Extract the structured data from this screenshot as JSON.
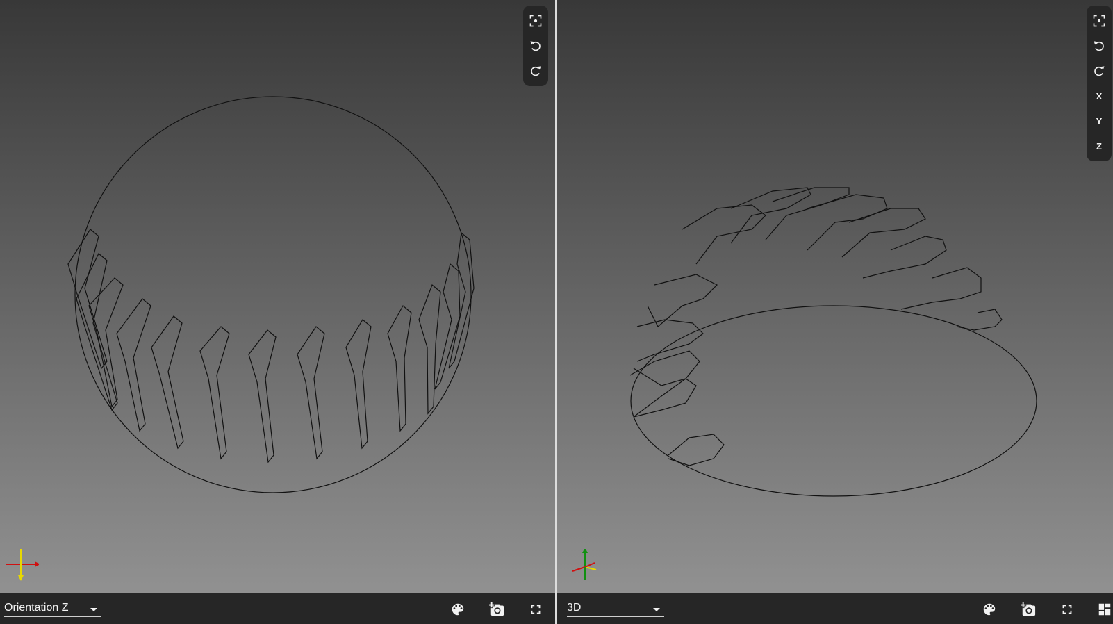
{
  "left_view": {
    "orientation_value": "Orientation Z",
    "toolbar": [
      {
        "icon": "fit-view-icon"
      },
      {
        "icon": "rotate-left-icon"
      },
      {
        "icon": "rotate-right-icon"
      }
    ],
    "bottom_icons": [
      "palette-icon",
      "screenshot-icon",
      "fullscreen-icon"
    ]
  },
  "right_view": {
    "orientation_value": "3D",
    "toolbar": [
      {
        "icon": "fit-view-icon"
      },
      {
        "icon": "rotate-left-icon"
      },
      {
        "icon": "rotate-right-icon"
      },
      {
        "icon": "axis-x",
        "label": "X"
      },
      {
        "icon": "axis-y",
        "label": "Y"
      },
      {
        "icon": "axis-z",
        "label": "Z"
      }
    ],
    "bottom_icons": [
      "palette-icon",
      "screenshot-icon",
      "fullscreen-icon",
      "layout-icon"
    ]
  },
  "colors": {
    "line": "#111111",
    "axis_x": "#d01010",
    "axis_y": "#e8d800",
    "axis_z": "#109010"
  }
}
